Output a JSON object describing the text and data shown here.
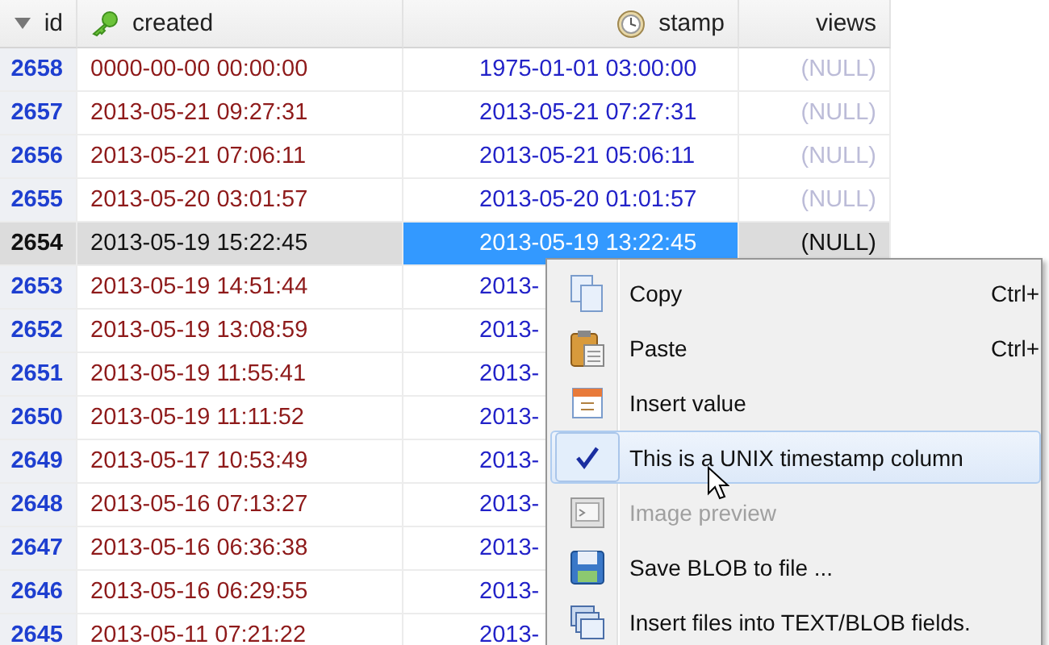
{
  "table": {
    "columns": [
      {
        "label": "id",
        "sorted": true
      },
      {
        "label": "created"
      },
      {
        "label": "stamp"
      },
      {
        "label": "views"
      }
    ],
    "rows": [
      {
        "id": "2658",
        "created": "0000-00-00 00:00:00",
        "stamp": "1975-01-01 03:00:00",
        "views": "(NULL)",
        "selected": false
      },
      {
        "id": "2657",
        "created": "2013-05-21 09:27:31",
        "stamp": "2013-05-21 07:27:31",
        "views": "(NULL)",
        "selected": false
      },
      {
        "id": "2656",
        "created": "2013-05-21 07:06:11",
        "stamp": "2013-05-21 05:06:11",
        "views": "(NULL)",
        "selected": false
      },
      {
        "id": "2655",
        "created": "2013-05-20 03:01:57",
        "stamp": "2013-05-20 01:01:57",
        "views": "(NULL)",
        "selected": false
      },
      {
        "id": "2654",
        "created": "2013-05-19 15:22:45",
        "stamp": "2013-05-19 13:22:45",
        "views": "(NULL)",
        "selected": true
      },
      {
        "id": "2653",
        "created": "2013-05-19 14:51:44",
        "stamp": "2013-",
        "selected": false
      },
      {
        "id": "2652",
        "created": "2013-05-19 13:08:59",
        "stamp": "2013-",
        "selected": false
      },
      {
        "id": "2651",
        "created": "2013-05-19 11:55:41",
        "stamp": "2013-",
        "selected": false
      },
      {
        "id": "2650",
        "created": "2013-05-19 11:11:52",
        "stamp": "2013-",
        "selected": false
      },
      {
        "id": "2649",
        "created": "2013-05-17 10:53:49",
        "stamp": "2013-",
        "selected": false
      },
      {
        "id": "2648",
        "created": "2013-05-16 07:13:27",
        "stamp": "2013-",
        "selected": false
      },
      {
        "id": "2647",
        "created": "2013-05-16 06:36:38",
        "stamp": "2013-",
        "selected": false
      },
      {
        "id": "2646",
        "created": "2013-05-16 06:29:55",
        "stamp": "2013-",
        "selected": false
      },
      {
        "id": "2645",
        "created": "2013-05-11 07:21:22",
        "stamp": "2013-",
        "selected": false
      }
    ]
  },
  "context_menu": {
    "items": [
      {
        "label": "Copy",
        "shortcut": "Ctrl+",
        "checked": false,
        "disabled": false,
        "highlighted": false
      },
      {
        "label": "Paste",
        "shortcut": "Ctrl+",
        "checked": false,
        "disabled": false,
        "highlighted": false
      },
      {
        "label": "Insert value",
        "checked": false,
        "disabled": false,
        "highlighted": false
      },
      {
        "label": "This is a UNIX timestamp column",
        "checked": true,
        "disabled": false,
        "highlighted": true
      },
      {
        "label": "Image preview",
        "checked": false,
        "disabled": true,
        "highlighted": false
      },
      {
        "label": "Save BLOB to file ...",
        "checked": false,
        "disabled": false,
        "highlighted": false
      },
      {
        "label": "Insert files into TEXT/BLOB fields.",
        "checked": false,
        "disabled": false,
        "highlighted": false
      }
    ]
  }
}
